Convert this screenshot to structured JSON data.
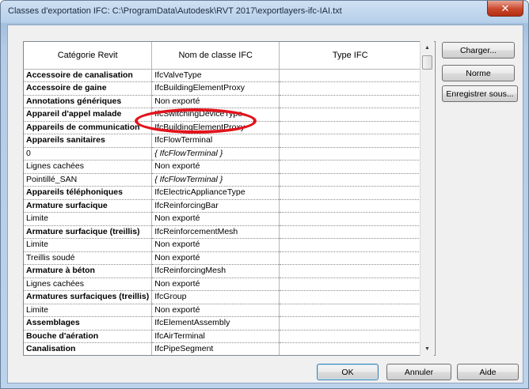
{
  "window": {
    "title": "Classes d'exportation IFC: C:\\ProgramData\\Autodesk\\RVT 2017\\exportlayers-ifc-IAI.txt",
    "close_glyph": "✕"
  },
  "table": {
    "headers": [
      "Catégorie Revit",
      "Nom de classe IFC",
      "Type IFC"
    ],
    "rows": [
      {
        "category": "Accessoire de canalisation",
        "ifc_class": "IfcValveType",
        "ifc_type": "",
        "bold": true,
        "italic": false
      },
      {
        "category": "Accessoire de gaine",
        "ifc_class": "IfcBuildingElementProxy",
        "ifc_type": "",
        "bold": true,
        "italic": false
      },
      {
        "category": "Annotations génériques",
        "ifc_class": "Non exporté",
        "ifc_type": "",
        "bold": true,
        "italic": false
      },
      {
        "category": "Appareil d'appel malade",
        "ifc_class": "IfcSwitchingDeviceType",
        "ifc_type": "",
        "bold": true,
        "italic": false
      },
      {
        "category": "Appareils de communication",
        "ifc_class": "IfcBuildingElementProxy",
        "ifc_type": "",
        "bold": true,
        "italic": false
      },
      {
        "category": "Appareils sanitaires",
        "ifc_class": "IfcFlowTerminal",
        "ifc_type": "",
        "bold": true,
        "italic": false
      },
      {
        "category": "0",
        "ifc_class": "{ IfcFlowTerminal }",
        "ifc_type": "",
        "bold": false,
        "italic": true
      },
      {
        "category": "Lignes cachées",
        "ifc_class": "Non exporté",
        "ifc_type": "",
        "bold": false,
        "italic": false
      },
      {
        "category": "Pointillé_SAN",
        "ifc_class": "{ IfcFlowTerminal }",
        "ifc_type": "",
        "bold": false,
        "italic": true
      },
      {
        "category": "Appareils téléphoniques",
        "ifc_class": "IfcElectricApplianceType",
        "ifc_type": "",
        "bold": true,
        "italic": false
      },
      {
        "category": "Armature surfacique",
        "ifc_class": "IfcReinforcingBar",
        "ifc_type": "",
        "bold": true,
        "italic": false
      },
      {
        "category": "Limite",
        "ifc_class": "Non exporté",
        "ifc_type": "",
        "bold": false,
        "italic": false
      },
      {
        "category": "Armature surfacique (treillis)",
        "ifc_class": "IfcReinforcementMesh",
        "ifc_type": "",
        "bold": true,
        "italic": false
      },
      {
        "category": "Limite",
        "ifc_class": "Non exporté",
        "ifc_type": "",
        "bold": false,
        "italic": false
      },
      {
        "category": "Treillis soudé",
        "ifc_class": "Non exporté",
        "ifc_type": "",
        "bold": false,
        "italic": false
      },
      {
        "category": "Armature à béton",
        "ifc_class": "IfcReinforcingMesh",
        "ifc_type": "",
        "bold": true,
        "italic": false
      },
      {
        "category": "Lignes cachées",
        "ifc_class": "Non exporté",
        "ifc_type": "",
        "bold": false,
        "italic": false
      },
      {
        "category": "Armatures surfaciques (treillis)",
        "ifc_class": "IfcGroup",
        "ifc_type": "",
        "bold": true,
        "italic": false
      },
      {
        "category": "Limite",
        "ifc_class": "Non exporté",
        "ifc_type": "",
        "bold": false,
        "italic": false
      },
      {
        "category": "Assemblages",
        "ifc_class": "IfcElementAssembly",
        "ifc_type": "",
        "bold": true,
        "italic": false
      },
      {
        "category": "Bouche d'aération",
        "ifc_class": "IfcAirTerminal",
        "ifc_type": "",
        "bold": true,
        "italic": false
      },
      {
        "category": "Canalisation",
        "ifc_class": "IfcPipeSegment",
        "ifc_type": "",
        "bold": true,
        "italic": false
      }
    ]
  },
  "scrollbar": {
    "up_glyph": "▲",
    "down_glyph": "▼"
  },
  "side_buttons": {
    "load": "Charger...",
    "standard": "Norme",
    "save_as": "Enregistrer sous..."
  },
  "footer_buttons": {
    "ok": "OK",
    "cancel": "Annuler",
    "help": "Aide"
  },
  "colors": {
    "annotation": "#e2141c",
    "close_button": "#c9472c"
  }
}
